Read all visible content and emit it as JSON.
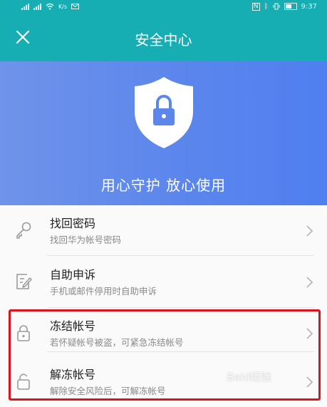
{
  "status_bar": {
    "carrier_badge": "K/s",
    "time": "9:37",
    "icons": [
      "signal-icon",
      "signal-icon",
      "wifi-icon",
      "message-icon",
      "nfc-icon",
      "bluetooth-icon",
      "vibrate-icon",
      "battery-icon"
    ]
  },
  "header": {
    "title": "安全中心",
    "close_icon": "close-icon"
  },
  "hero": {
    "slogan": "用心守护 放心使用",
    "icon": "shield-lock-icon",
    "gradient": [
      "#6f93ea",
      "#4f7ff0"
    ]
  },
  "menu": {
    "items": [
      {
        "title": "找回密码",
        "subtitle": "找回华为帐号密码",
        "icon": "key-icon"
      },
      {
        "title": "自助申诉",
        "subtitle": "手机或邮件停用时自助申诉",
        "icon": "edit-icon"
      },
      {
        "title": "冻结帐号",
        "subtitle": "若怀疑帐号被盗，可紧急冻结帐号",
        "icon": "lock-closed-icon"
      },
      {
        "title": "解冻帐号",
        "subtitle": "解除安全风险后，可解冻帐号",
        "icon": "lock-open-icon"
      }
    ]
  },
  "annotation": {
    "color": "#e0111d"
  },
  "watermark": {
    "text": "Baid经验"
  },
  "colors": {
    "header": "#17aeb3",
    "accent_red": "#e0111d"
  }
}
